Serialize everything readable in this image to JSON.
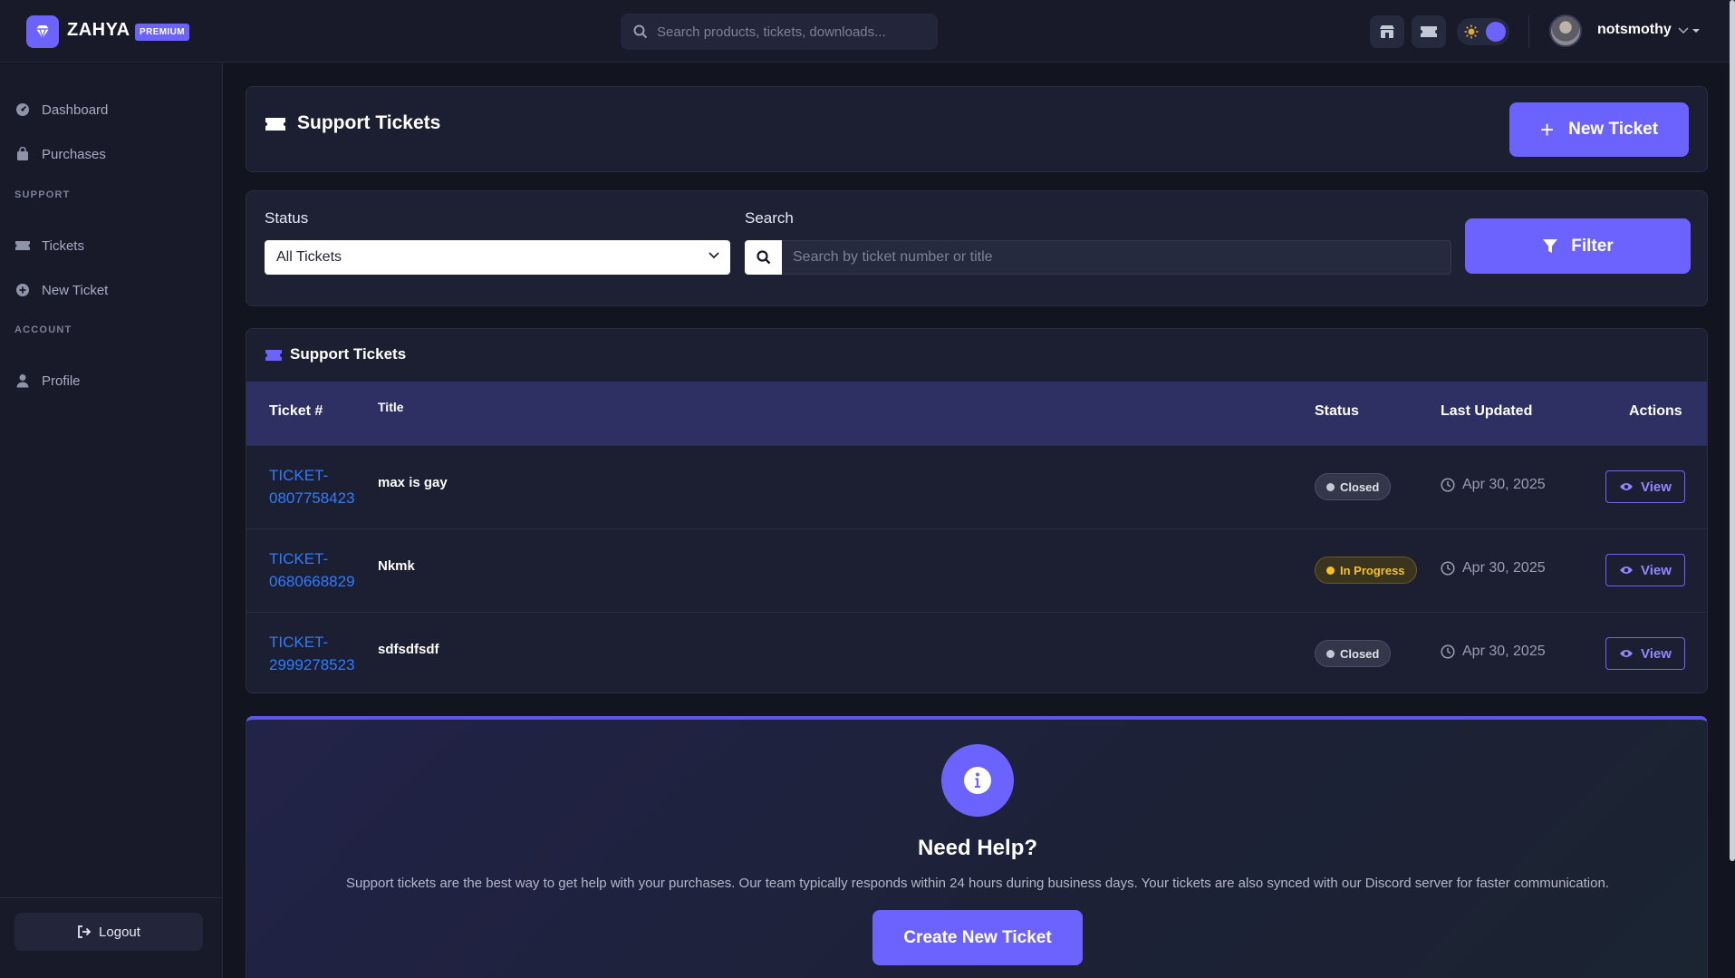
{
  "topbar": {
    "brand": "ZAHYA",
    "badge": "PREMIUM",
    "search_placeholder": "Search products, tickets, downloads...",
    "username": "notsmothy"
  },
  "sidebar": {
    "items": [
      {
        "label": "Dashboard",
        "icon": "dashboard-icon"
      },
      {
        "label": "Purchases",
        "icon": "bag-icon"
      }
    ],
    "support_heading": "SUPPORT",
    "support_items": [
      {
        "label": "Tickets",
        "icon": "ticket-icon"
      },
      {
        "label": "New Ticket",
        "icon": "plus-circle-icon"
      }
    ],
    "account_heading": "ACCOUNT",
    "account_items": [
      {
        "label": "Profile",
        "icon": "user-icon"
      }
    ],
    "logout_label": "Logout"
  },
  "header": {
    "title": "Support Tickets",
    "new_ticket_label": "New Ticket"
  },
  "filters": {
    "status_label": "Status",
    "status_value": "All Tickets",
    "search_label": "Search",
    "search_placeholder": "Search by ticket number or title",
    "filter_label": "Filter"
  },
  "table": {
    "title": "Support Tickets",
    "columns": [
      "Ticket #",
      "Title",
      "Status",
      "Last Updated",
      "Actions"
    ],
    "rows": [
      {
        "ticket_a": "TICKET-",
        "ticket_b": "0807758423",
        "title": "max is gay",
        "status": "Closed",
        "updated": "Apr 30, 2025",
        "action": "View"
      },
      {
        "ticket_a": "TICKET-",
        "ticket_b": "0680668829",
        "title": "Nkmk",
        "status": "In Progress",
        "updated": "Apr 30, 2025",
        "action": "View"
      },
      {
        "ticket_a": "TICKET-",
        "ticket_b": "2999278523",
        "title": "sdfsdfsdf",
        "status": "Closed",
        "updated": "Apr 30, 2025",
        "action": "View"
      }
    ]
  },
  "help": {
    "title": "Need Help?",
    "text": "Support tickets are the best way to get help with your purchases. Our team typically responds within 24 hours during business days. Your tickets are also synced with our Discord server for faster communication.",
    "button_label": "Create New Ticket"
  },
  "colors": {
    "accent": "#6c63ff",
    "link": "#2f7bff",
    "in_progress": "#f6c11a"
  }
}
